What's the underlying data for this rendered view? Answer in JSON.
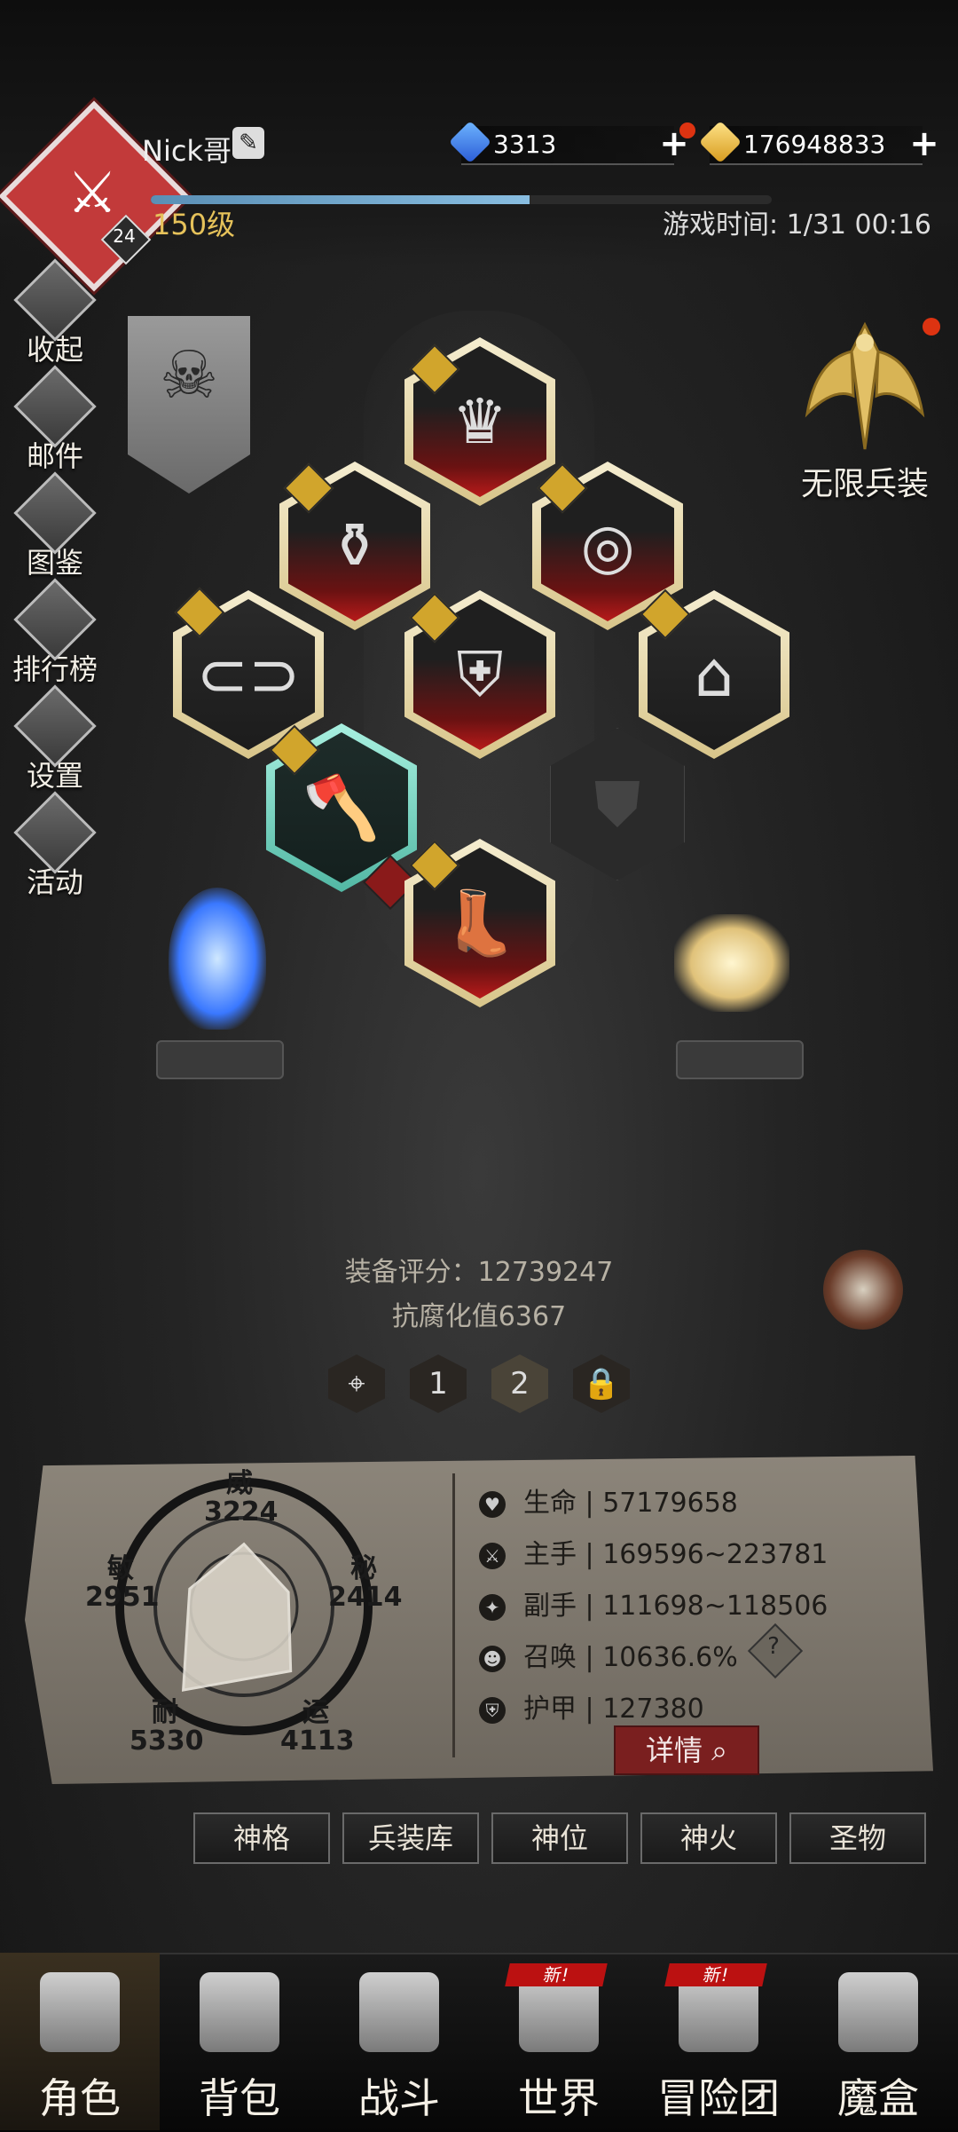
{
  "player": {
    "name": "Nick哥",
    "level": "150级",
    "avatar_level": "24",
    "xp_progress": 0.61
  },
  "currency": {
    "gems": "3313",
    "gold": "176948833"
  },
  "game_time": "游戏时间: 1/31 00:16",
  "left_menu": [
    "收起",
    "邮件",
    "图鉴",
    "排行榜",
    "设置",
    "活动"
  ],
  "infinite_gear": "无限兵装",
  "equipment": {
    "score": "装备评分：12739247",
    "corruption": "抗腐化值6367"
  },
  "pages": [
    "1",
    "2"
  ],
  "radar": {
    "wei": {
      "label": "威",
      "value": "3224"
    },
    "mi": {
      "label": "秘",
      "value": "2414"
    },
    "min": {
      "label": "敏",
      "value": "2951"
    },
    "nai": {
      "label": "耐",
      "value": "5330"
    },
    "yun": {
      "label": "运",
      "value": "4113"
    }
  },
  "stats": [
    {
      "label": "生命",
      "value": "57179658"
    },
    {
      "label": "主手",
      "value": "169596~223781"
    },
    {
      "label": "副手",
      "value": "111698~118506"
    },
    {
      "label": "召唤",
      "value": "10636.6%"
    },
    {
      "label": "护甲",
      "value": "127380"
    }
  ],
  "detail_button": "详情",
  "sub_tabs": [
    "神格",
    "兵装库",
    "神位",
    "神火",
    "圣物"
  ],
  "nav": [
    "角色",
    "背包",
    "战斗",
    "世界",
    "冒险团",
    "魔盒"
  ],
  "new_tag": "新!"
}
